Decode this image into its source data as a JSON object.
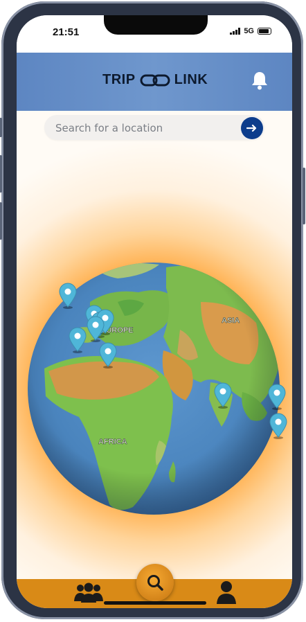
{
  "status_bar": {
    "time": "21:51",
    "network": "5G"
  },
  "header": {
    "logo_left": "TRIP",
    "logo_right": "LINK",
    "bell_icon": "bell-icon"
  },
  "search": {
    "placeholder": "Search for a location",
    "value": "",
    "submit_icon": "arrow-right-icon"
  },
  "globe": {
    "labels": {
      "europe": "EUROPE",
      "asia": "ASIA",
      "africa": "AFRICA"
    },
    "pins_count": 10
  },
  "bottom_nav": {
    "left_icon": "group-icon",
    "center_icon": "search-icon",
    "right_icon": "person-icon"
  },
  "colors": {
    "header": "#6f97cd",
    "accent_blue": "#0d3d8c",
    "nav_orange": "#d98a17",
    "pin": "#4fb6d8"
  }
}
